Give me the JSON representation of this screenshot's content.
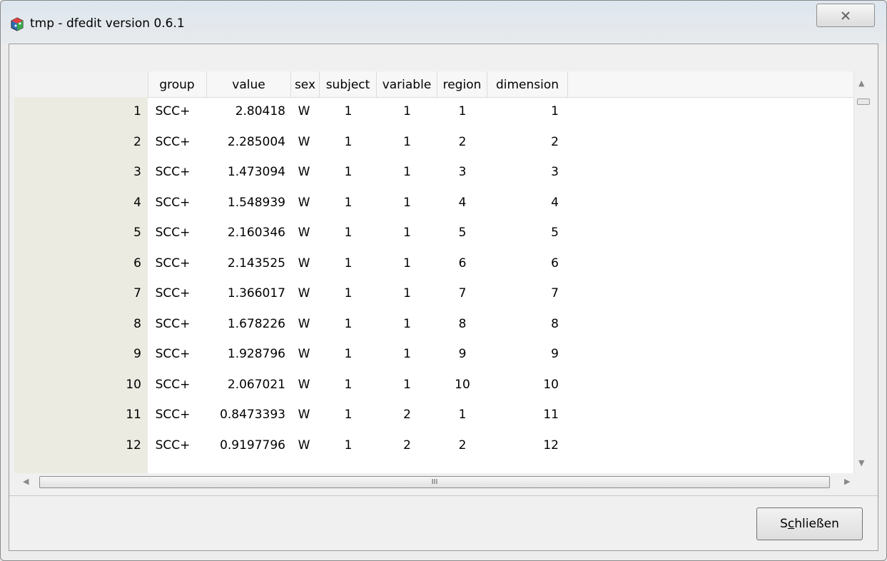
{
  "window": {
    "title": "tmp - dfedit version 0.6.1"
  },
  "grid": {
    "columns": [
      "group",
      "value",
      "sex",
      "subject",
      "variable",
      "region",
      "dimension"
    ],
    "rows": [
      {
        "num": "1",
        "group": "SCC+",
        "value": "2.80418",
        "sex": "W",
        "subject": "1",
        "variable": "1",
        "region": "1",
        "dimension": "1"
      },
      {
        "num": "2",
        "group": "SCC+",
        "value": "2.285004",
        "sex": "W",
        "subject": "1",
        "variable": "1",
        "region": "2",
        "dimension": "2"
      },
      {
        "num": "3",
        "group": "SCC+",
        "value": "1.473094",
        "sex": "W",
        "subject": "1",
        "variable": "1",
        "region": "3",
        "dimension": "3"
      },
      {
        "num": "4",
        "group": "SCC+",
        "value": "1.548939",
        "sex": "W",
        "subject": "1",
        "variable": "1",
        "region": "4",
        "dimension": "4"
      },
      {
        "num": "5",
        "group": "SCC+",
        "value": "2.160346",
        "sex": "W",
        "subject": "1",
        "variable": "1",
        "region": "5",
        "dimension": "5"
      },
      {
        "num": "6",
        "group": "SCC+",
        "value": "2.143525",
        "sex": "W",
        "subject": "1",
        "variable": "1",
        "region": "6",
        "dimension": "6"
      },
      {
        "num": "7",
        "group": "SCC+",
        "value": "1.366017",
        "sex": "W",
        "subject": "1",
        "variable": "1",
        "region": "7",
        "dimension": "7"
      },
      {
        "num": "8",
        "group": "SCC+",
        "value": "1.678226",
        "sex": "W",
        "subject": "1",
        "variable": "1",
        "region": "8",
        "dimension": "8"
      },
      {
        "num": "9",
        "group": "SCC+",
        "value": "1.928796",
        "sex": "W",
        "subject": "1",
        "variable": "1",
        "region": "9",
        "dimension": "9"
      },
      {
        "num": "10",
        "group": "SCC+",
        "value": "2.067021",
        "sex": "W",
        "subject": "1",
        "variable": "1",
        "region": "10",
        "dimension": "10"
      },
      {
        "num": "11",
        "group": "SCC+",
        "value": "0.8473393",
        "sex": "W",
        "subject": "1",
        "variable": "2",
        "region": "1",
        "dimension": "11"
      },
      {
        "num": "12",
        "group": "SCC+",
        "value": "0.9197796",
        "sex": "W",
        "subject": "1",
        "variable": "2",
        "region": "2",
        "dimension": "12"
      }
    ],
    "scroll_thumb_glyph": "III"
  },
  "footer": {
    "close_label_prefix": "S",
    "close_label_accel": "c",
    "close_label_rest": "hließen"
  },
  "colors": {
    "rownum_bg": "#ecebe1",
    "header_bg": "#f7f7f7"
  }
}
